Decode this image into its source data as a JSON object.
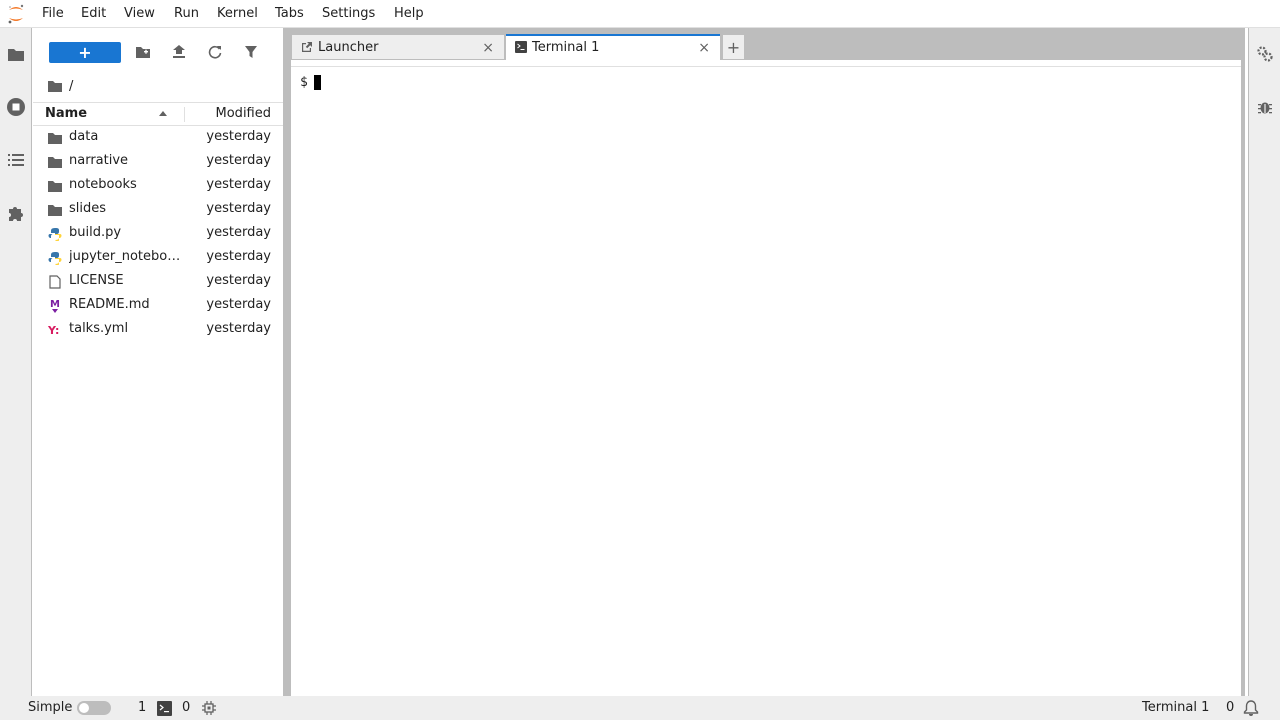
{
  "menu": [
    "File",
    "Edit",
    "View",
    "Run",
    "Kernel",
    "Tabs",
    "Settings",
    "Help"
  ],
  "filebrowser": {
    "new_button": "+",
    "breadcrumb": "/",
    "columns": {
      "name": "Name",
      "modified": "Modified"
    },
    "files": [
      {
        "name": "data",
        "type": "folder",
        "modified": "yesterday"
      },
      {
        "name": "narrative",
        "type": "folder",
        "modified": "yesterday"
      },
      {
        "name": "notebooks",
        "type": "folder",
        "modified": "yesterday"
      },
      {
        "name": "slides",
        "type": "folder",
        "modified": "yesterday"
      },
      {
        "name": "build.py",
        "type": "python",
        "modified": "yesterday"
      },
      {
        "name": "jupyter_notebo…",
        "type": "python",
        "modified": "yesterday"
      },
      {
        "name": "LICENSE",
        "type": "file",
        "modified": "yesterday"
      },
      {
        "name": "README.md",
        "type": "markdown",
        "modified": "yesterday"
      },
      {
        "name": "talks.yml",
        "type": "yaml",
        "modified": "yesterday"
      }
    ]
  },
  "tabs": [
    {
      "label": "Launcher",
      "icon": "launcher-icon",
      "close": "×"
    },
    {
      "label": "Terminal 1",
      "icon": "terminal-icon",
      "close": "×"
    }
  ],
  "tab_add": "+",
  "terminal": {
    "prompt": "$"
  },
  "statusbar": {
    "mode_label": "Simple",
    "kernels_count": "1",
    "terminals_count": "0",
    "current": "Terminal 1",
    "notifications": "0"
  },
  "colors": {
    "accent": "#1976d2",
    "panel": "#eeeeee",
    "border": "#bdbdbd",
    "folder": "#616161"
  }
}
